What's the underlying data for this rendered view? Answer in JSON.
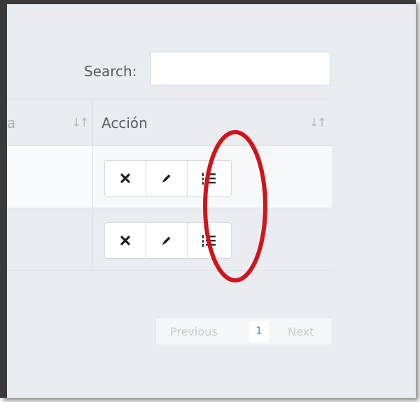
{
  "search": {
    "label": "Search:",
    "value": "",
    "placeholder": ""
  },
  "table": {
    "header": {
      "col1_fragment": "a",
      "col2_title": "Acción"
    },
    "rows": [
      {
        "actions": [
          "delete",
          "edit",
          "list"
        ]
      },
      {
        "actions": [
          "delete",
          "edit",
          "list"
        ]
      }
    ]
  },
  "pagination": {
    "previous": "Previous",
    "page": "1",
    "next": "Next"
  },
  "icons": {
    "sort": "sort-icon",
    "delete": "times-icon",
    "edit": "pencil-icon",
    "list": "list-ordered-icon"
  },
  "colors": {
    "background": "#e9edf1",
    "annotation": "#d0141a",
    "active_page": "#3d8fc9"
  }
}
